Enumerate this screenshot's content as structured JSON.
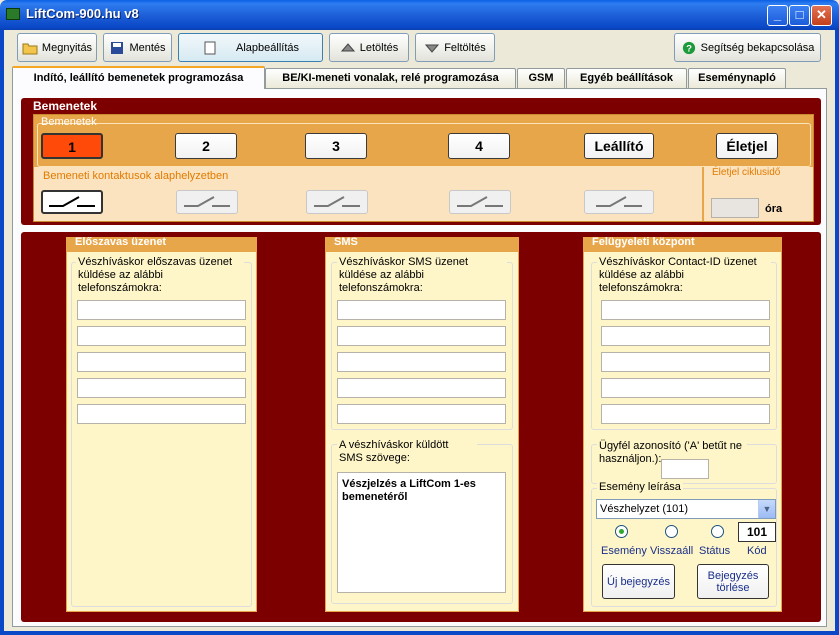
{
  "window": {
    "title": "LiftCom-900.hu   v8",
    "minimize": "_",
    "maximize": "□",
    "close": "✕"
  },
  "toolbar": {
    "open": "Megnyitás",
    "save": "Mentés",
    "defaults": "Alapbeállítás",
    "download": "Letöltés",
    "upload": "Feltöltés",
    "help": "Segítség bekapcsolása"
  },
  "tabs": [
    "Indító, leállító bemenetek programozása",
    "BE/KI-meneti vonalak, relé programozása",
    "GSM",
    "Egyéb beállítások",
    "Eseménynapló"
  ],
  "inputs": {
    "section_title": "Bemenetek",
    "inner_title": "Bemenetek",
    "buttons": [
      "1",
      "2",
      "3",
      "4",
      "Leállító",
      "Életjel"
    ],
    "contact_title": "Bemeneti kontaktusok alaphelyzetben",
    "eletjel_title": "Életjel ciklusidő",
    "eletjel_unit": "óra"
  },
  "eloszavas": {
    "title": "Előszavas üzenet",
    "group": "Vészhíváskor előszavas üzenet küldése az alábbi telefonszámokra:"
  },
  "sms": {
    "title": "SMS",
    "group": "Vészhíváskor SMS üzenet küldése az alábbi telefonszámokra:",
    "text_group": "A vészhíváskor küldött SMS szövege:",
    "text_value": "Vészjelzés a LiftCom 1-es bemenetéről"
  },
  "felugyeleti": {
    "title": "Felügyeleti központ",
    "group": "Vészhíváskor Contact-ID üzenet küldése az alábbi telefonszámokra:",
    "client_id_label": "Ügyfél azonosító ('A' betűt ne használjon.):",
    "event_group": "Esemény leírása",
    "event_select": "Vészhelyzet (101)",
    "radio_labels": [
      "Esemény",
      "Visszaáll",
      "Státus"
    ],
    "code_label": "Kód",
    "code_value": "101",
    "new_entry": "Új bejegyzés",
    "delete_entry": "Bejegyzés törlése"
  },
  "colors": {
    "accent": "#e8a64a",
    "maroon": "#7d0000",
    "active_input": "#ff4a0a",
    "panel_bg": "#fef6c8"
  }
}
